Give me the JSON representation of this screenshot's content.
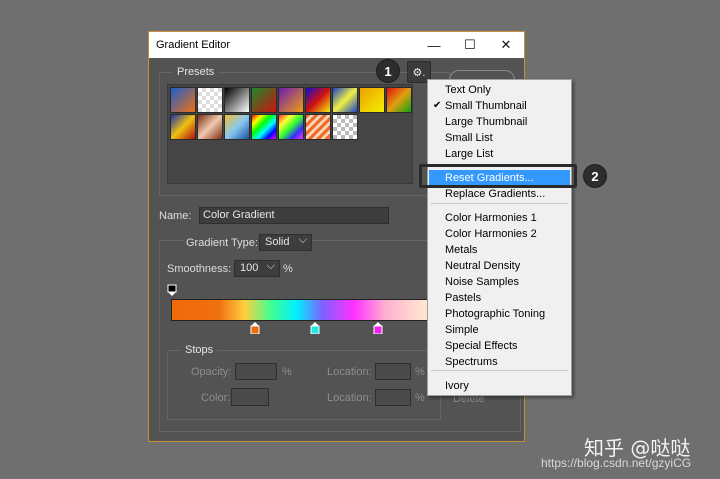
{
  "window": {
    "title": "Gradient Editor",
    "minimize": "—",
    "maximize": "☐",
    "close": "✕"
  },
  "presets": {
    "label": "Presets",
    "gear_glyph": "⚙.",
    "swatches": [
      "linear-gradient(135deg,#1a5fd0,#f07010)",
      "repeating-conic-gradient(#ddd 0 25%,#fff 0 50%) 0 0/8px 8px, linear-gradient(135deg,#f05a28,transparent)",
      "linear-gradient(135deg,#000,#fff)",
      "linear-gradient(135deg,#1a8a2a,#d01010)",
      "linear-gradient(135deg,#6a1ab0,#f0a010)",
      "linear-gradient(135deg,#1010d0,#d01010,#f0f010)",
      "linear-gradient(135deg,#1a40d0,#f0f040,#1a40d0)",
      "linear-gradient(135deg,#f0a000,#f0f000)",
      "linear-gradient(135deg,#e01010,#e0a010,#10a010)",
      "linear-gradient(135deg,#1a30b0,#f0c010,#b01010)",
      "linear-gradient(135deg,#7a3010,#f0c8b0,#7a3010)",
      "linear-gradient(135deg,#f0c030,#8ac8f0,#1a50a0)",
      "linear-gradient(135deg,#ff0000,#ffff00,#00ff00,#00ffff,#0000ff,#ff00ff)",
      "linear-gradient(135deg,#ff3030,#ffff30,#30ff30,#3030ff,#ff30ff)",
      "repeating-linear-gradient(135deg,#f06a28 0 3px,#f8d8b8 3px 6px)",
      "repeating-conic-gradient(#bbb 0 25%,#fff 0 50%) 0 0/8px 8px"
    ]
  },
  "badges": {
    "one": "1",
    "two": "2"
  },
  "name": {
    "label": "Name:",
    "value": "Color Gradient"
  },
  "gradient_type": {
    "label": "Gradient Type:",
    "value": "Solid",
    "chevron": "⌵"
  },
  "smoothness": {
    "label": "Smoothness:",
    "value": "100",
    "unit": "%",
    "chevron": "⌵"
  },
  "stops": {
    "label": "Stops",
    "opacity_label": "Opacity:",
    "opacity_unit": "%",
    "location_label_1": "Location:",
    "location_unit_1": "%",
    "color_label": "Color:",
    "location_label_2": "Location:",
    "location_unit_2": "%",
    "delete_label": "Delete"
  },
  "color_stops": [
    {
      "color": "#f06a0a",
      "position": 0.32
    },
    {
      "color": "#20e8e0",
      "position": 0.55
    },
    {
      "color": "#f020f0",
      "position": 0.79
    }
  ],
  "menu": {
    "items": [
      {
        "label": "Text Only",
        "checked": false
      },
      {
        "label": "Small Thumbnail",
        "checked": true
      },
      {
        "label": "Large Thumbnail",
        "checked": false
      },
      {
        "label": "Small List",
        "checked": false
      },
      {
        "label": "Large List",
        "checked": false
      },
      {
        "label": "Reset Gradients...",
        "highlighted": true
      },
      {
        "label": "Replace Gradients..."
      },
      {
        "label": "Color Harmonies 1"
      },
      {
        "label": "Color Harmonies 2"
      },
      {
        "label": "Metals"
      },
      {
        "label": "Neutral Density"
      },
      {
        "label": "Noise Samples"
      },
      {
        "label": "Pastels"
      },
      {
        "label": "Photographic Toning"
      },
      {
        "label": "Simple"
      },
      {
        "label": "Special Effects"
      },
      {
        "label": "Spectrums"
      },
      {
        "label": "Ivory"
      }
    ],
    "check_glyph": "✔"
  },
  "watermark": {
    "main": "知乎 @哒哒",
    "url": "https://blog.csdn.net/gzyiCG"
  }
}
